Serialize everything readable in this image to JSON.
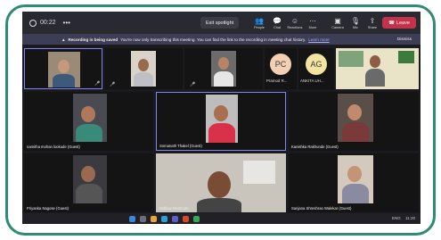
{
  "topbar": {
    "time": "00:22",
    "exit_spotlight": "Exit spotlight",
    "buttons": [
      {
        "icon": "people-icon",
        "label": "People"
      },
      {
        "icon": "chat-icon",
        "label": "Chat"
      },
      {
        "icon": "reactions-icon",
        "label": "Reactions"
      },
      {
        "icon": "more-icon",
        "label": "More"
      },
      {
        "icon": "camera-icon",
        "label": "Camera"
      },
      {
        "icon": "mic-icon",
        "label": "Mic"
      },
      {
        "icon": "share-icon",
        "label": "Share"
      }
    ],
    "leave": "Leave"
  },
  "banner": {
    "title": "Recording is being saved",
    "text": "You're now only transcribing this meeting. You can find the link to the recording in meeting chat history.",
    "link": "Learn more",
    "dismiss": "Dismiss"
  },
  "participants": [
    {
      "name": "",
      "initials": ""
    },
    {
      "name": "",
      "initials": ""
    },
    {
      "name": "",
      "initials": ""
    },
    {
      "name": "Pramod R...",
      "initials": "PC"
    },
    {
      "name": "ANKITA UH...",
      "initials": "AG"
    },
    {
      "name": "",
      "initials": ""
    },
    {
      "name": "namitha mohan lookude (Guest)",
      "initials": ""
    },
    {
      "name": "Somanath Thakel (Guest)",
      "initials": ""
    },
    {
      "name": "Kanishka Rakhunde (Guest)",
      "initials": ""
    },
    {
      "name": "Priyanka Nagose (Guest)",
      "initials": ""
    },
    {
      "name": "Vaibhav Meshram",
      "initials": ""
    },
    {
      "name": "Sanjana Shreshrao Walekar (Guest)",
      "initials": ""
    }
  ],
  "taskbar": {
    "lang": "ENG",
    "time": "11:20"
  },
  "colors": {
    "frame": "#2e8c72",
    "leave": "#c4314b",
    "avatar_pc": "#f3cfb3",
    "avatar_ag": "#f1e3a0",
    "active_border": "#7f85f5"
  }
}
